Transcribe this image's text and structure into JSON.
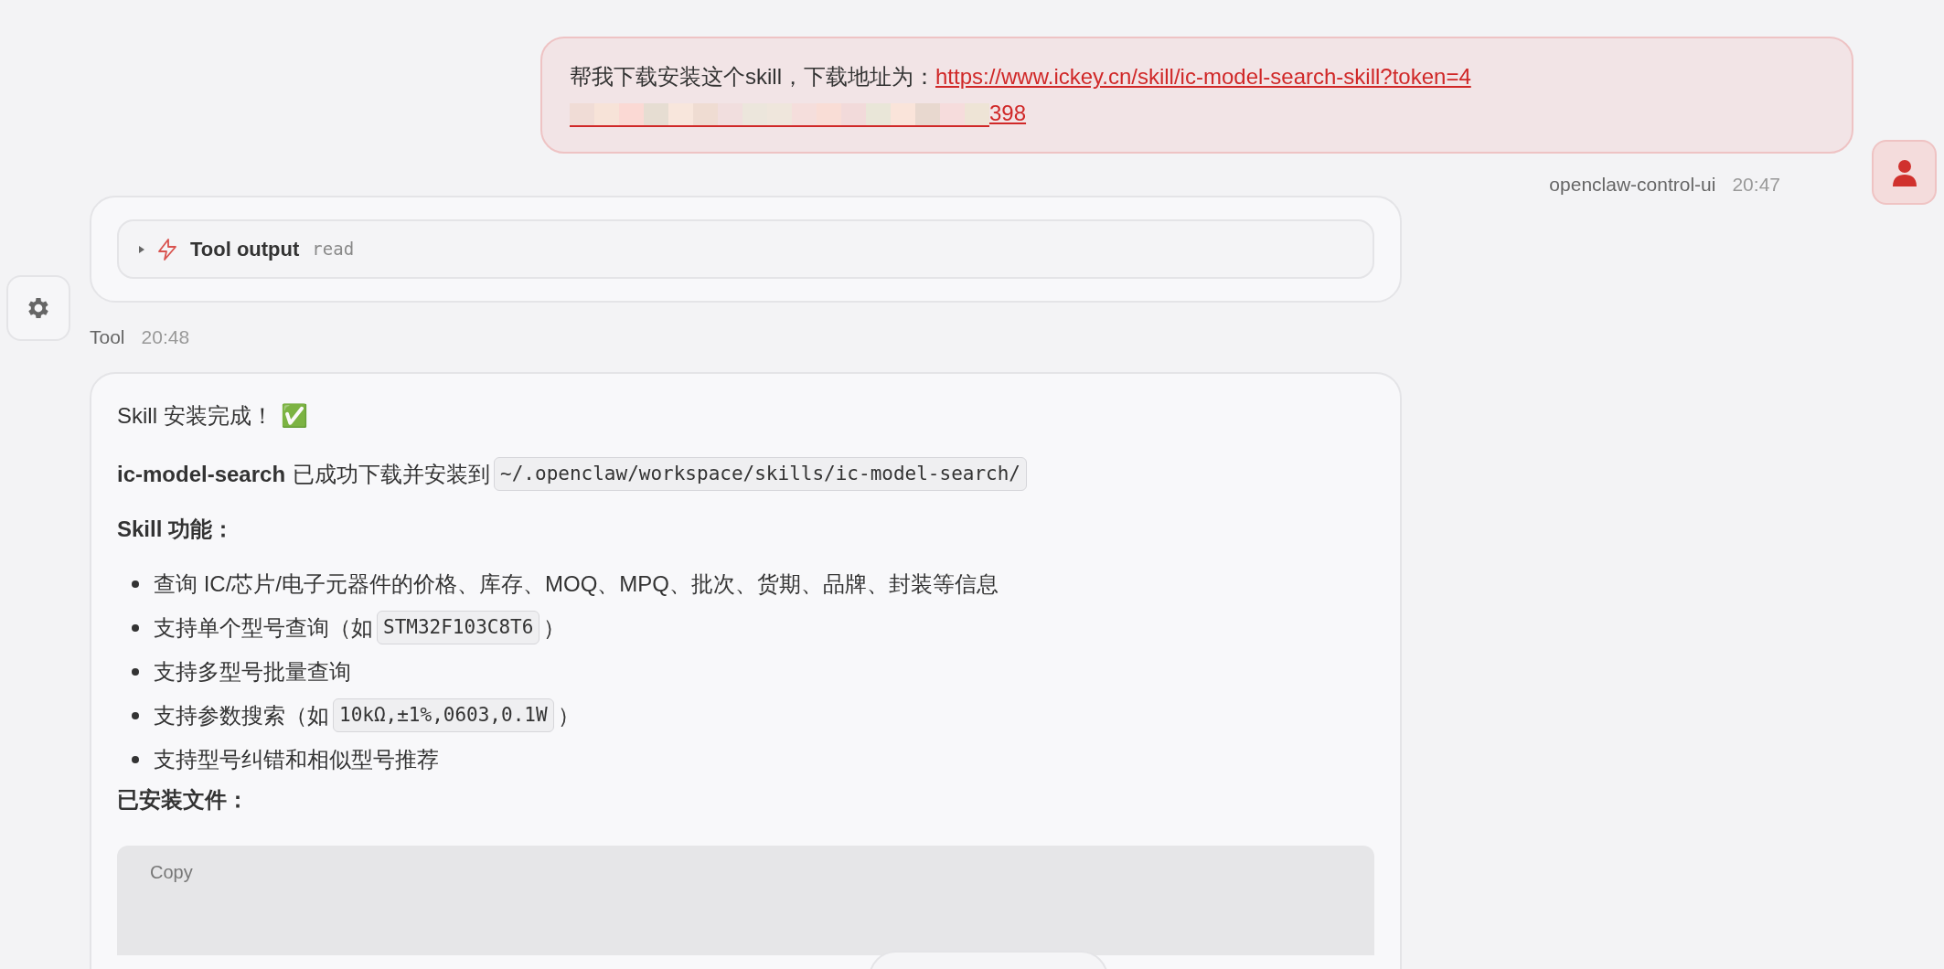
{
  "user_message": {
    "text": "帮我下载安装这个skill，下载地址为：",
    "link_start": "https://www.ickey.cn/skill/ic-model-search-skill?token=4",
    "link_end": "398",
    "sender": "openclaw-control-ui",
    "time": "20:47"
  },
  "tool_card": {
    "expanded": false,
    "title": "Tool output",
    "tool": "read",
    "sender": "Tool",
    "time": "20:48"
  },
  "reply": {
    "heading": "Skill 安装完成！",
    "heading_emoji": "✅",
    "intro_name": "ic-model-search",
    "intro_text": "已成功下载并安装到",
    "intro_path": "~/.openclaw/workspace/skills/ic-model-search/",
    "features_title": "Skill 功能：",
    "features": [
      {
        "text": "查询 IC/芯片/电子元器件的价格、库存、MOQ、MPQ、批次、货期、品牌、封装等信息"
      },
      {
        "text": "支持单个型号查询（如",
        "code": "STM32F103C8T6",
        "after": "）"
      },
      {
        "text": "支持多型号批量查询"
      },
      {
        "text": "支持参数搜索（如",
        "code": "10kΩ,±1%,0603,0.1W",
        "after": "）"
      },
      {
        "text": "支持型号纠错和相似型号推荐"
      }
    ],
    "files_title": "已安装文件：",
    "copy_label": "Copy"
  }
}
